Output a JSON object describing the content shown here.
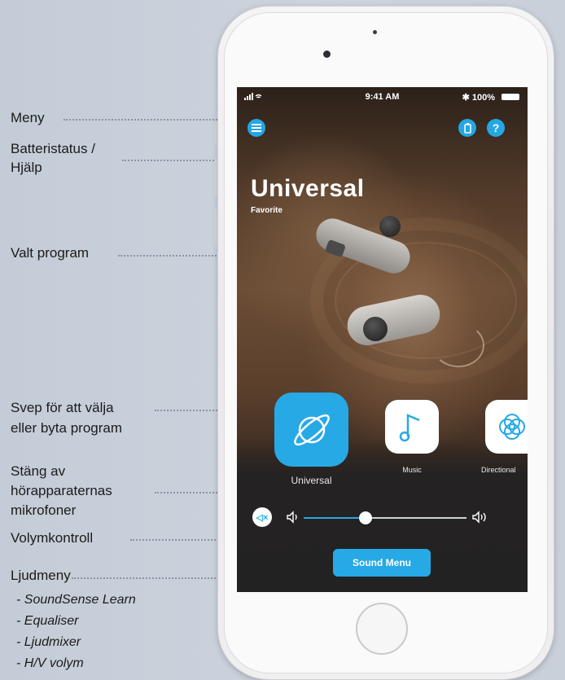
{
  "annotations": {
    "menu": "Meny",
    "battery_help_line1": "Batteristatus /",
    "battery_help_line2": "Hjälp",
    "selected_program": "Valt program",
    "swipe_line1": "Svep för att välja",
    "swipe_line2": "eller byta program",
    "mute_line1": "Stäng av",
    "mute_line2": "hörapparaternas",
    "mute_line3": "mikrofoner",
    "volume": "Volymkontroll",
    "sound_menu": "Ljudmeny",
    "sound_menu_items": [
      "- SoundSense Learn",
      "- Equaliser",
      "- Ljudmixer",
      "- H/V volym"
    ]
  },
  "status_bar": {
    "time": "9:41 AM",
    "battery": "100%"
  },
  "program": {
    "name": "Universal",
    "tag": "Favorite"
  },
  "program_carousel": [
    {
      "label": "Universal",
      "icon": "planet-icon",
      "active": true
    },
    {
      "label": "Music",
      "icon": "music-note-icon",
      "active": false
    },
    {
      "label": "Directional",
      "icon": "directional-icon",
      "active": false
    }
  ],
  "volume": {
    "level_fraction": 0.38
  },
  "sound_menu_button": "Sound Menu",
  "colors": {
    "accent": "#27a9e6",
    "background": "#c9d1dc",
    "leader_dots": "#8f93a0"
  }
}
